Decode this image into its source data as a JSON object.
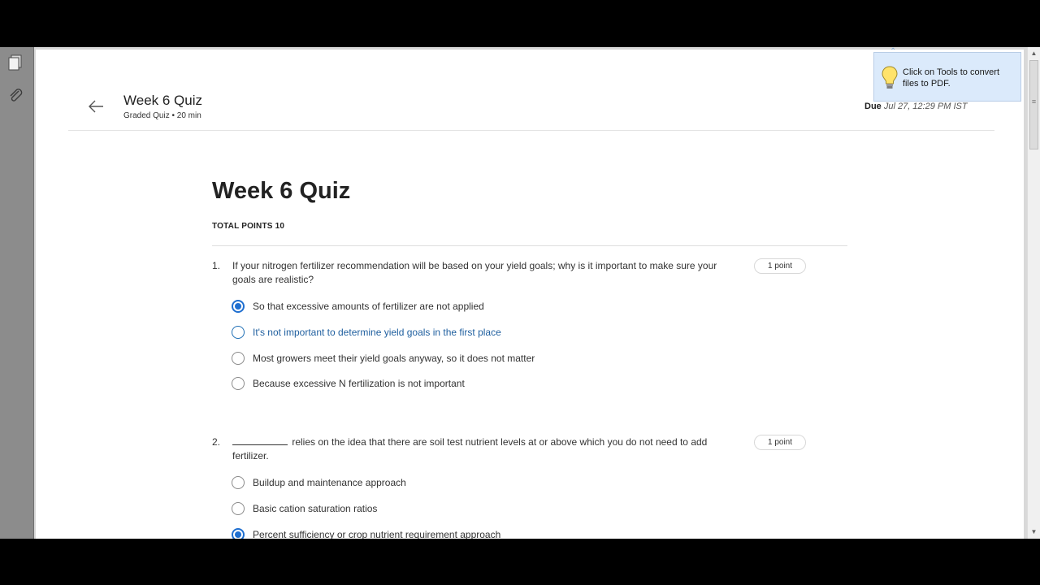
{
  "header": {
    "title": "Week 6 Quiz",
    "subtitle": "Graded Quiz • 20 min",
    "due_label": "Due",
    "due_value": "Jul 27, 12:29 PM IST"
  },
  "quiz": {
    "title": "Week 6 Quiz",
    "total_points": "TOTAL POINTS 10"
  },
  "questions": [
    {
      "number": "1.",
      "text": "If your nitrogen fertilizer recommendation will be based on your yield goals; why is it important to make sure your goals are realistic?",
      "points": "1 point",
      "options": [
        {
          "label": "So that excessive amounts of fertilizer are not applied",
          "selected": true
        },
        {
          "label": "It's not important to determine yield goals in the first place",
          "selected": false
        },
        {
          "label": "Most growers meet their yield goals anyway, so it does not matter",
          "selected": false
        },
        {
          "label": "Because excessive N fertilization is not important",
          "selected": false
        }
      ]
    },
    {
      "number": "2.",
      "text": "relies on the idea that there are soil test nutrient levels at or above which you do not need to add fertilizer.",
      "points": "1 point",
      "options": [
        {
          "label": "Buildup and maintenance approach",
          "selected": false
        },
        {
          "label": "Basic cation saturation ratios",
          "selected": false
        },
        {
          "label": "Percent sufficiency or crop nutrient requirement approach",
          "selected": true
        }
      ]
    }
  ],
  "tooltip": {
    "text": "Click on Tools to convert files to PDF."
  },
  "icons": {
    "back": "arrow-left-icon",
    "pages": "pages-icon",
    "attachments": "paperclip-icon",
    "tip": "lightbulb-icon"
  },
  "colors": {
    "accent": "#1f6fd0",
    "hover_text": "#1f5f9f",
    "tooltip_bg": "#dbeafb"
  }
}
